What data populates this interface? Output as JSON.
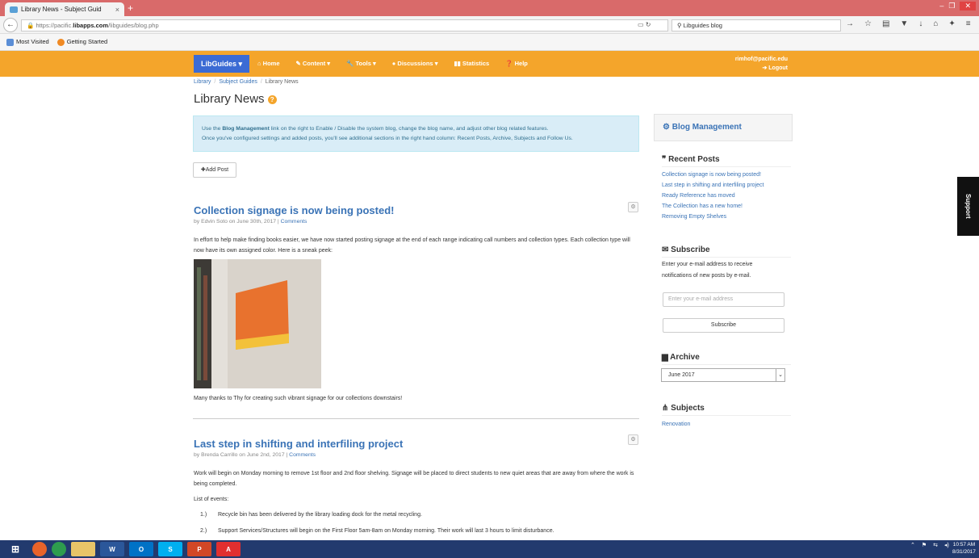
{
  "browser": {
    "tab_title": "Library News - Subject Guid",
    "tab_close": "×",
    "new_tab": "+",
    "url_prefix": "https://pacific.",
    "url_domain": "libapps.com",
    "url_path": "/libguides/blog.php",
    "search_value": "Libguides blog",
    "bookmarks": [
      "Most Visited",
      "Getting Started"
    ],
    "win_controls": [
      "–",
      "❐",
      "✕"
    ]
  },
  "header": {
    "brand": "LibGuides ▾",
    "nav": [
      "Home",
      "Content ▾",
      "Tools ▾",
      "Discussions ▾",
      "Statistics",
      "Help"
    ],
    "user_email": "rimhof@pacific.edu",
    "logout": "Logout"
  },
  "breadcrumb": [
    "Library",
    "Subject Guides",
    "Library News"
  ],
  "page_title": "Library News",
  "info": {
    "line1_pre": "Use the ",
    "line1_bold": "Blog Management",
    "line1_post": " link on the right to Enable / Disable the system blog, change the blog name, and adjust other blog related features.",
    "line2": "Once you've configured settings and added posts, you'll see additional sections in the right hand column: Recent Posts, Archive, Subjects and Follow Us."
  },
  "add_post": "Add Post",
  "posts": [
    {
      "title": "Collection signage is now being posted!",
      "byline": "by Edvin Soto on June 30th, 2017 | ",
      "comments": "Comments",
      "para1": "In effort to help make finding books easier, we have now started posting signage at the end of each range indicating call numbers and collection types. Each collection type will now have its own assigned color. Here is a sneak peek:",
      "para2": "Many thanks to Thy for creating such vibrant signage for our collections downstairs!"
    },
    {
      "title": "Last step in shifting and interfiling project",
      "byline": "by Brenda Carrillo on June 2nd, 2017 | ",
      "comments": "Comments",
      "para1": "Work will begin on Monday morning to remove 1st floor and 2nd floor shelving. Signage will be placed to direct students to new quiet areas that are away from where the work is being completed.",
      "list_title": "List of events:",
      "events": [
        {
          "num": "1.)",
          "text": "Recycle bin has been delivered by the library loading dock for the metal recycling."
        },
        {
          "num": "2.)",
          "text": "Support Services/Structures will begin on the First Floor 5am-8am on Monday morning.  Their work will last 3 hours to limit disturbance."
        }
      ]
    }
  ],
  "sidebar": {
    "blog_management": "Blog Management",
    "recent_posts_title": "Recent Posts",
    "recent_posts": [
      "Collection signage is now being posted!",
      "Last step in shifting and interfiling project",
      "Ready Reference has moved",
      "The Collection has a new home!",
      "Removing Empty Shelves"
    ],
    "subscribe_title": "Subscribe",
    "subscribe_text": "Enter your e-mail address to receive notifications of new posts by e-mail.",
    "email_placeholder": "Enter your e-mail address",
    "subscribe_button": "Subscribe",
    "archive_title": "Archive",
    "archive_selected": "June 2017",
    "subjects_title": "Subjects",
    "subjects": [
      "Renovation"
    ]
  },
  "support_tab": "Support",
  "taskbar": {
    "time": "10:57 AM",
    "date": "8/31/2017"
  }
}
